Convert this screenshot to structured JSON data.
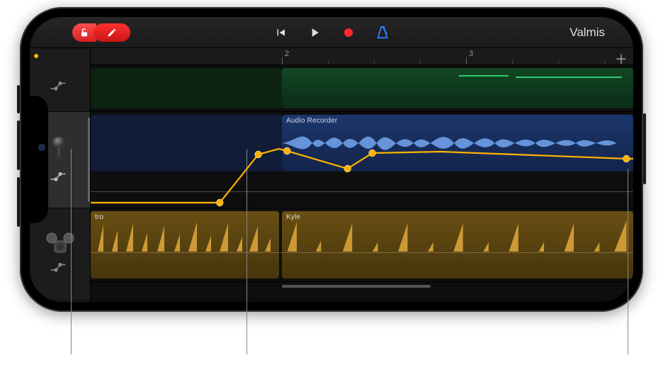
{
  "toolbar": {
    "done_label": "Valmis"
  },
  "ruler": {
    "markers": [
      "2",
      "3"
    ]
  },
  "tracks": {
    "audio_region_label": "Audio Recorder",
    "drum_region_a_label": "tro",
    "drum_region_b_label": "Kyle"
  },
  "colors": {
    "automation": "#ffb300",
    "record": "#ff2a2a",
    "accent_blue": "#2a7fff"
  }
}
